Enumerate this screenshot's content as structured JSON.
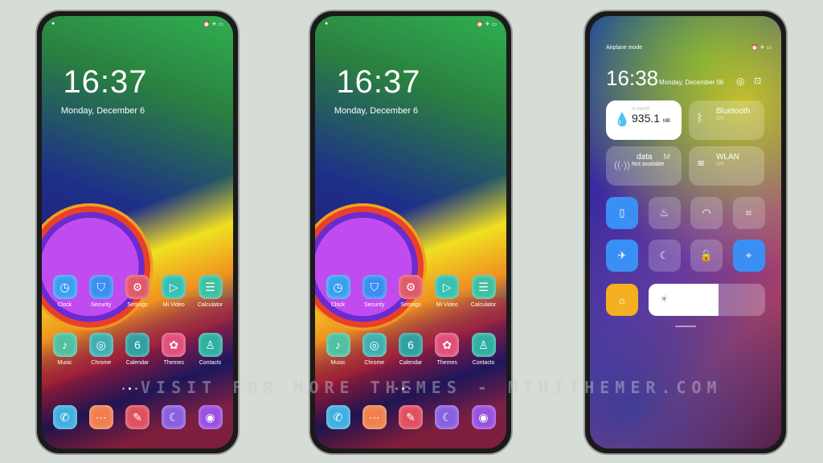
{
  "lockscreen": {
    "time": "16:37",
    "date": "Monday, December 6"
  },
  "apps": [
    [
      {
        "label": "Clock",
        "icon": "clock-icon",
        "glyph": "◷",
        "color": "#3aa0f0"
      },
      {
        "label": "Security",
        "icon": "shield-icon",
        "glyph": "⛉",
        "color": "#3a8ff0"
      },
      {
        "label": "Settings",
        "icon": "gear-icon",
        "glyph": "⚙",
        "color": "#e05a6a"
      },
      {
        "label": "Mi Video",
        "icon": "play-icon",
        "glyph": "▷",
        "color": "#3ac0b0"
      },
      {
        "label": "Calculator",
        "icon": "calculator-icon",
        "glyph": "☰",
        "color": "#40c0a0"
      }
    ],
    [
      {
        "label": "Music",
        "icon": "music-note-icon",
        "glyph": "♪",
        "color": "#50c0a0"
      },
      {
        "label": "Chrome",
        "icon": "chrome-icon",
        "glyph": "◎",
        "color": "#40b0b0"
      },
      {
        "label": "Calendar",
        "icon": "calendar-icon",
        "glyph": "6",
        "color": "#30a0a0"
      },
      {
        "label": "Themes",
        "icon": "brush-icon",
        "glyph": "✿",
        "color": "#e0507a"
      },
      {
        "label": "Contacts",
        "icon": "contact-icon",
        "glyph": "♙",
        "color": "#30b0a0"
      }
    ],
    [
      {
        "label": "",
        "icon": "phone-icon",
        "glyph": "✆",
        "color": "#40b0e0"
      },
      {
        "label": "",
        "icon": "message-icon",
        "glyph": "⋯",
        "color": "#f08050"
      },
      {
        "label": "",
        "icon": "feather-icon",
        "glyph": "✎",
        "color": "#e05060"
      },
      {
        "label": "",
        "icon": "gallery-icon",
        "glyph": "☾",
        "color": "#8a60e0"
      },
      {
        "label": "",
        "icon": "camera-icon",
        "glyph": "◉",
        "color": "#9a50e0"
      }
    ]
  ],
  "page_indicator": {
    "count": 3,
    "active": 1
  },
  "control_center": {
    "status": "Airplane mode",
    "time": "16:38",
    "date": "Monday, December 06",
    "data_tile": {
      "caption": "is month",
      "value": "935.1",
      "unit": "MB"
    },
    "bluetooth": {
      "label": "Bluetooth",
      "state": "Off"
    },
    "mobile_data": {
      "label": "data",
      "extra": "M",
      "state": "Not available"
    },
    "wlan": {
      "label": "WLAN",
      "state": "Off"
    },
    "toggles": [
      {
        "icon": "vibrate-icon",
        "glyph": "▯",
        "active": true
      },
      {
        "icon": "flashlight-icon",
        "glyph": "♨",
        "active": false
      },
      {
        "icon": "lamp-icon",
        "glyph": "◠",
        "active": false
      },
      {
        "icon": "crop-icon",
        "glyph": "⌗",
        "active": false
      },
      {
        "icon": "airplane-icon",
        "glyph": "✈",
        "active": true
      },
      {
        "icon": "moon-icon",
        "glyph": "☾",
        "active": false
      },
      {
        "icon": "lock-icon",
        "glyph": "🔓",
        "active": false
      },
      {
        "icon": "location-icon",
        "glyph": "⌖",
        "active": true
      }
    ],
    "brightness": 60
  },
  "watermark": "VISIT FOR MORE THEMES - MIUITHEMER.COM",
  "colors": {
    "accent": "#3a8ff5",
    "sun": "#f5b021"
  }
}
